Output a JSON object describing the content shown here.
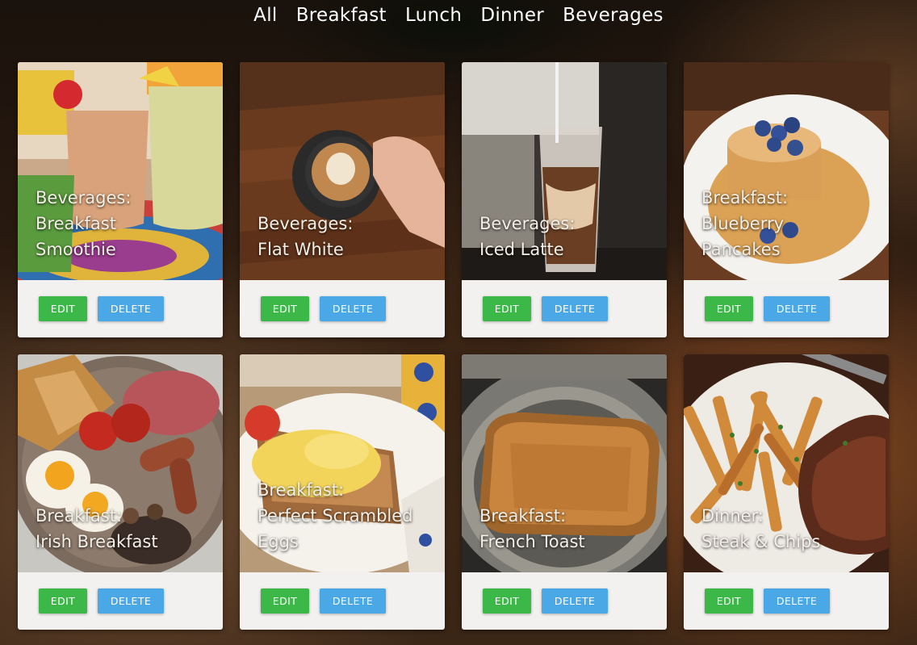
{
  "nav": {
    "items": [
      {
        "label": "All"
      },
      {
        "label": "Breakfast"
      },
      {
        "label": "Lunch"
      },
      {
        "label": "Dinner"
      },
      {
        "label": "Beverages"
      }
    ]
  },
  "cards": [
    {
      "category": "Beverages:",
      "name": "Breakfast Smoothie",
      "name_lines": [
        "Breakfast",
        "Smoothie"
      ],
      "image": "smoothie-photo",
      "edit_label": "EDIT",
      "delete_label": "DELETE"
    },
    {
      "category": "Beverages:",
      "name": "Flat White",
      "name_lines": [
        "Flat White"
      ],
      "image": "flat-white-photo",
      "edit_label": "EDIT",
      "delete_label": "DELETE"
    },
    {
      "category": "Beverages:",
      "name": "Iced Latte",
      "name_lines": [
        "Iced Latte"
      ],
      "image": "iced-latte-photo",
      "edit_label": "EDIT",
      "delete_label": "DELETE"
    },
    {
      "category": "Breakfast:",
      "name": "Blueberry Pancakes",
      "name_lines": [
        "Blueberry",
        "Pancakes"
      ],
      "image": "pancakes-photo",
      "edit_label": "EDIT",
      "delete_label": "DELETE"
    },
    {
      "category": "Breakfast:",
      "name": "Irish Breakfast",
      "name_lines": [
        "Irish Breakfast"
      ],
      "image": "irish-breakfast-photo",
      "edit_label": "EDIT",
      "delete_label": "DELETE"
    },
    {
      "category": "Breakfast:",
      "name": "Perfect Scrambled Eggs",
      "name_lines": [
        "Perfect Scrambled",
        "Eggs"
      ],
      "image": "scrambled-eggs-photo",
      "edit_label": "EDIT",
      "delete_label": "DELETE"
    },
    {
      "category": "Breakfast:",
      "name": "French Toast",
      "name_lines": [
        "French Toast"
      ],
      "image": "french-toast-photo",
      "edit_label": "EDIT",
      "delete_label": "DELETE"
    },
    {
      "category": "Dinner:",
      "name": "Steak & Chips",
      "name_lines": [
        "Steak & Chips"
      ],
      "image": "steak-chips-photo",
      "edit_label": "EDIT",
      "delete_label": "DELETE"
    }
  ],
  "colors": {
    "edit_button": "#3bb847",
    "delete_button": "#4aa8e6",
    "card_footer": "#f2f1f0",
    "nav_text": "#ffffff"
  }
}
